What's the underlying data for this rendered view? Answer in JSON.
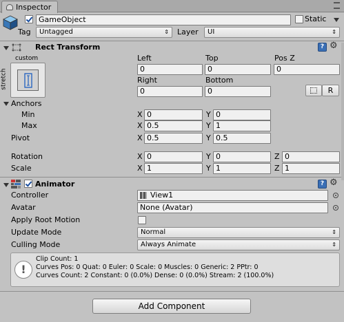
{
  "tab": {
    "title": "Inspector"
  },
  "gameobject": {
    "name": "GameObject",
    "static_label": "Static",
    "tag_label": "Tag",
    "tag_value": "Untagged",
    "layer_label": "Layer",
    "layer_value": "UI"
  },
  "rect_transform": {
    "title": "Rect Transform",
    "anchor_preset_top": "custom",
    "anchor_preset_side": "stretch",
    "col_headers": {
      "left": "Left",
      "top": "Top",
      "posz": "Pos Z",
      "right": "Right",
      "bottom": "Bottom"
    },
    "values": {
      "left": "0",
      "top": "0",
      "posz": "0",
      "right": "0",
      "bottom": "0"
    },
    "raw_button": "R",
    "anchors_label": "Anchors",
    "min_label": "Min",
    "max_label": "Max",
    "pivot_label": "Pivot",
    "rotation_label": "Rotation",
    "scale_label": "Scale",
    "axis_x": "X",
    "axis_y": "Y",
    "axis_z": "Z",
    "min": {
      "x": "0",
      "y": "0"
    },
    "max": {
      "x": "0.5",
      "y": "1"
    },
    "pivot": {
      "x": "0.5",
      "y": "0.5"
    },
    "rotation": {
      "x": "0",
      "y": "0",
      "z": "0"
    },
    "scale": {
      "x": "1",
      "y": "1",
      "z": "1"
    }
  },
  "animator": {
    "title": "Animator",
    "controller_label": "Controller",
    "controller_value": "View1",
    "avatar_label": "Avatar",
    "avatar_value": "None (Avatar)",
    "apply_root_motion_label": "Apply Root Motion",
    "update_mode_label": "Update Mode",
    "update_mode_value": "Normal",
    "culling_mode_label": "Culling Mode",
    "culling_mode_value": "Always Animate",
    "info": {
      "line1": "Clip Count: 1",
      "line2": "Curves Pos: 0 Quat: 0 Euler: 0 Scale: 0 Muscles: 0 Generic: 2 PPtr: 0",
      "line3": "Curves Count: 2 Constant: 0 (0.0%) Dense: 0 (0.0%) Stream: 2 (100.0%)"
    }
  },
  "add_component_label": "Add Component",
  "colors": {
    "panel": "#c2c2c2",
    "tab": "#dadada",
    "field": "#f0f0f0"
  }
}
